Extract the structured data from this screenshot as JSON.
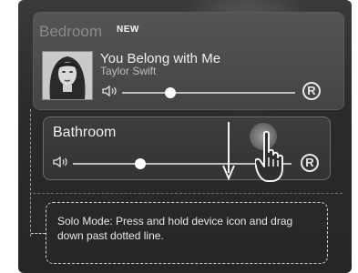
{
  "bedroom": {
    "room_name": "Bedroom",
    "badge": "NEW",
    "song_title": "You Belong with Me",
    "artist": "Taylor Swift",
    "volume_level": 0.28,
    "r_button": "R",
    "icons": {
      "album": "album-art",
      "volume": "speaker-icon"
    }
  },
  "bathroom": {
    "room_name": "Bathroom",
    "volume_level": 0.31,
    "r_button": "R",
    "icons": {
      "volume": "speaker-icon",
      "gesture": "hand-pointer-icon",
      "arrow": "down-arrow-icon"
    }
  },
  "tooltip": {
    "text": "Solo Mode: Press and hold device icon and drag down past dotted line."
  },
  "colors": {
    "background": "#2b2b2b",
    "card": "#4a4a4a",
    "text": "#f0f0f0",
    "muted_title": "#8a8a8a"
  }
}
